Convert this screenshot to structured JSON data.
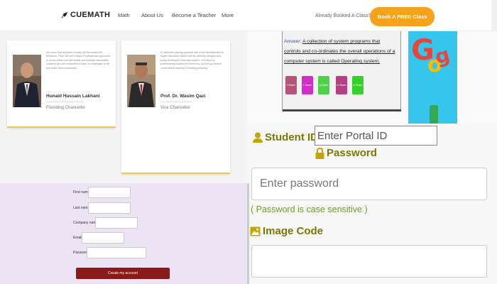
{
  "navbar": {
    "brand": "CUEMATH",
    "links": [
      "Math",
      "About Us",
      "Become a Teacher",
      "More"
    ],
    "already_booked": "Already Booked A Class?",
    "cta_label": "Book A FREE Class",
    "cta_color": "#f7a21b"
  },
  "people": [
    {
      "bio": "We know that students of today are the leaders of tomorrow. Thus, we form unique Professionals grounded in sound ethics who are leader and socially responsible students who are competent to take on challenges in life and make them successful.",
      "name": "Hunaid Hussain Lakhani",
      "role": "Founding Chancellor"
    },
    {
      "bio": "IU has been playing a pivotal role in the development of higher education sector with its visionary designs and policy thinking in University system. IU's flood of professionals leaders for tomorrow, and we go beyond conventional learning in teaching learning.",
      "name": "Prof. Dr. Wasim Qazi",
      "role": "Vice Chancellor"
    }
  ],
  "quiz": {
    "answer_label": "Answer:",
    "answer_text": "A collection of system programs that controls and co-ordinates the overall operations of a computer system is called Operating system.",
    "share_buttons": [
      {
        "label": "Share",
        "icon": "facebook-icon",
        "color": "#b5547b"
      },
      {
        "label": "Tweet",
        "icon": "twitter-icon",
        "color": "#d12fc8"
      },
      {
        "label": "Share",
        "icon": "google-plus-icon",
        "color": "#4fd14a"
      },
      {
        "label": "Share",
        "icon": "linkedin-icon",
        "color": "#b83e86"
      },
      {
        "label": "Share",
        "icon": "whatsapp-icon",
        "color": "#35d12a"
      }
    ]
  },
  "login": {
    "student_id_label": "Student ID",
    "student_id_placeholder": "Enter Portal ID",
    "password_label": "Password",
    "password_placeholder": "Enter password",
    "password_hint": "( Password is case sensitive )",
    "image_code_label": "Image Code",
    "label_color": "#7a7a00",
    "hint_color": "#6d9c2a"
  },
  "signup": {
    "fields": [
      {
        "label": "First name"
      },
      {
        "label": "Last name"
      },
      {
        "label": "Company name"
      },
      {
        "label": "Email"
      },
      {
        "label": "Password"
      }
    ],
    "submit_label": "Create my account",
    "submit_color": "#8a1a1a"
  }
}
